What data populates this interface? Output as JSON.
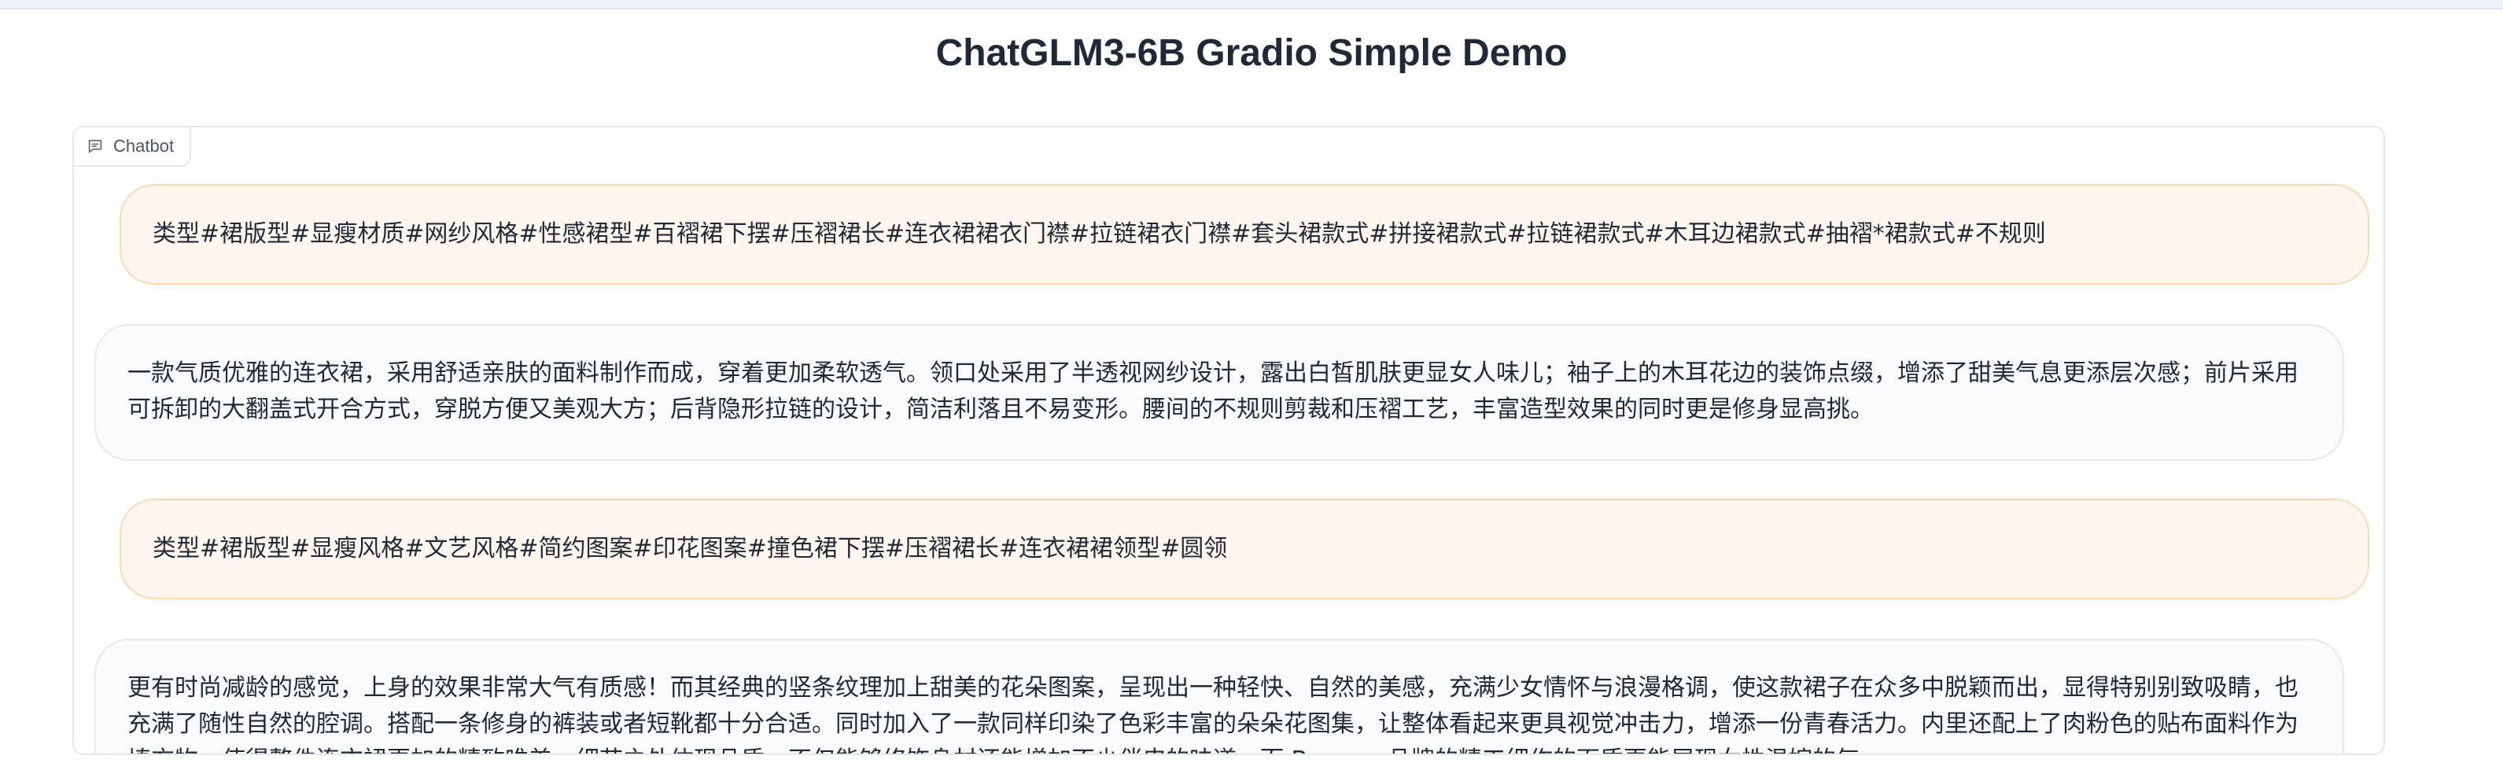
{
  "page": {
    "title": "ChatGLM3-6B Gradio Simple Demo"
  },
  "chatbot": {
    "label": "Chatbot",
    "label_icon": "chat-bubble-icon",
    "messages": [
      {
        "role": "user",
        "text": "类型#裙版型#显瘦材质#网纱风格#性感裙型#百褶裙下摆#压褶裙长#连衣裙裙衣门襟#拉链裙衣门襟#套头裙款式#拼接裙款式#拉链裙款式#木耳边裙款式#抽褶*裙款式#不规则"
      },
      {
        "role": "assistant",
        "text": "一款气质优雅的连衣裙，采用舒适亲肤的面料制作而成，穿着更加柔软透气。领口处采用了半透视网纱设计，露出白皙肌肤更显女人味儿；袖子上的木耳花边的装饰点缀，增添了甜美气息更添层次感；前片采用可拆卸的大翻盖式开合方式，穿脱方便又美观大方；后背隐形拉链的设计，简洁利落且不易变形。腰间的不规则剪裁和压褶工艺，丰富造型效果的同时更是修身显高挑。"
      },
      {
        "role": "user",
        "text": "类型#裙版型#显瘦风格#文艺风格#简约图案#印花图案#撞色裙下摆#压褶裙长#连衣裙裙领型#圆领"
      },
      {
        "role": "assistant",
        "text": "更有时尚减龄的感觉，上身的效果非常大气有质感！而其经典的竖条纹理加上甜美的花朵图案，呈现出一种轻快、自然的美感，充满少女情怀与浪漫格调，使这款裙子在众多中脱颖而出，显得特别别致吸睛，也充满了随性自然的腔调。搭配一条修身的裤装或者短靴都十分合适。同时加入了一款同样印染了色彩丰富的朵朵花图集，让整体看起来更具视觉冲击力，增添一份青春活力。内里还配上了肉粉色的贴布面料作为填充物，使得整件连衣裙更加的精致唯美，细节之处体现品质，不仅能够修饰身材还能增加不少俏皮的味道，而 Bresser 品牌的精工细作的面质更能展现女性温婉的气"
      }
    ]
  }
}
